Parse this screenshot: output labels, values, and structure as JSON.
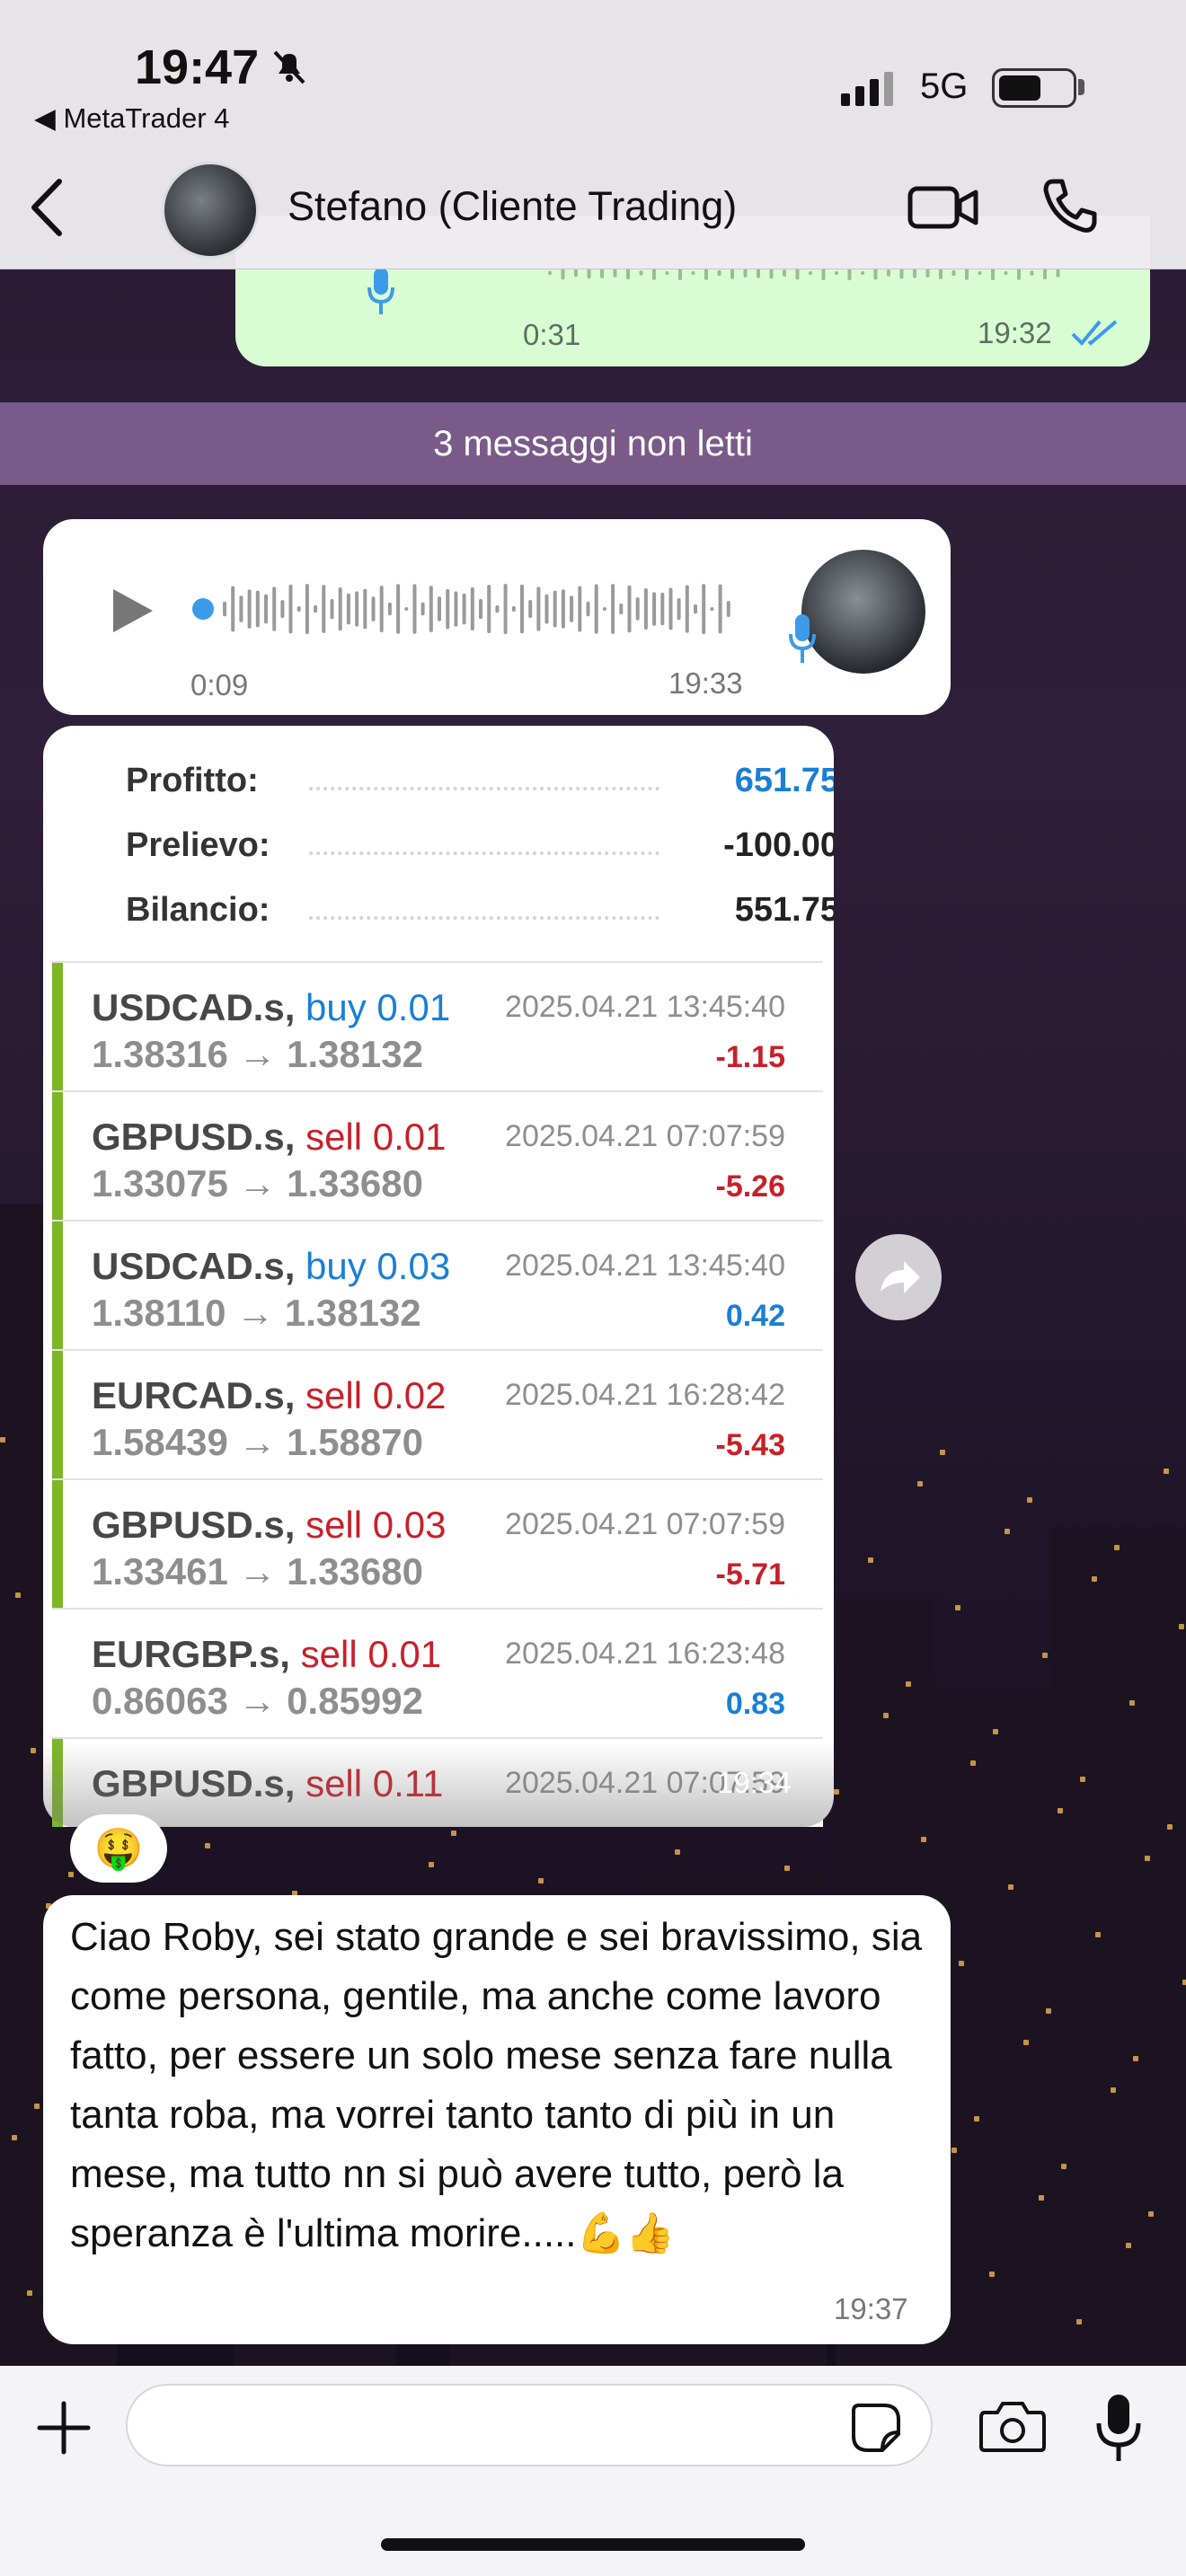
{
  "status_bar": {
    "time": "19:47",
    "back_app_label": "◀ MetaTrader 4",
    "network": "5G"
  },
  "header": {
    "contact_name": "Stefano (Cliente Trading)"
  },
  "outgoing_voice": {
    "duration": "0:31",
    "time": "19:32"
  },
  "unread_banner": "3 messaggi non letti",
  "incoming_voice": {
    "duration": "0:09",
    "time": "19:33"
  },
  "mt4_summary": [
    {
      "label": "Profitto:",
      "value": "651.75",
      "color": "#1a7fd4"
    },
    {
      "label": "Prelievo:",
      "value": "-100.00",
      "color": "#222222"
    },
    {
      "label": "Bilancio:",
      "value": "551.75",
      "color": "#222222"
    }
  ],
  "trades": [
    {
      "symbol": "USDCAD.s,",
      "side": "buy 0.01",
      "side_color": "#1a7fd4",
      "prices": "1.38316 → 1.38132",
      "datetime": "2025.04.21 13:45:40",
      "pl": "-1.15",
      "pl_color": "#c8202a",
      "bar": true
    },
    {
      "symbol": "GBPUSD.s,",
      "side": "sell 0.01",
      "side_color": "#c8202a",
      "prices": "1.33075 → 1.33680",
      "datetime": "2025.04.21 07:07:59",
      "pl": "-5.26",
      "pl_color": "#c8202a",
      "bar": true
    },
    {
      "symbol": "USDCAD.s,",
      "side": "buy 0.03",
      "side_color": "#1a7fd4",
      "prices": "1.38110 → 1.38132",
      "datetime": "2025.04.21 13:45:40",
      "pl": "0.42",
      "pl_color": "#1a7fd4",
      "bar": true
    },
    {
      "symbol": "EURCAD.s,",
      "side": "sell 0.02",
      "side_color": "#c8202a",
      "prices": "1.58439 → 1.58870",
      "datetime": "2025.04.21 16:28:42",
      "pl": "-5.43",
      "pl_color": "#c8202a",
      "bar": true
    },
    {
      "symbol": "GBPUSD.s,",
      "side": "sell 0.03",
      "side_color": "#c8202a",
      "prices": "1.33461 → 1.33680",
      "datetime": "2025.04.21 07:07:59",
      "pl": "-5.71",
      "pl_color": "#c8202a",
      "bar": true
    },
    {
      "symbol": "EURGBP.s,",
      "side": "sell 0.01",
      "side_color": "#c8202a",
      "prices": "0.86063 → 0.85992",
      "datetime": "2025.04.21 16:23:48",
      "pl": "0.83",
      "pl_color": "#1a7fd4",
      "bar": false
    },
    {
      "symbol": "GBPUSD.s,",
      "side": "sell 0.11",
      "side_color": "#c8202a",
      "prices": "",
      "datetime": "2025.04.21 07:07:59",
      "pl": "",
      "pl_color": "#c8202a",
      "bar": true
    }
  ],
  "image_time": "19:34",
  "reaction": "🤑",
  "text_message": {
    "text": "Ciao Roby, sei stato grande e sei bravissimo, sia come persona, gentile, ma anche come lavoro fatto, per essere un solo mese senza fare nulla tanta roba, ma vorrei tanto tanto di più in un mese, ma tutto nn si può avere tutto, però la speranza è l'ultima morire.....💪👍",
    "time": "19:37"
  },
  "colors": {
    "accent_blue": "#1a7fd4",
    "loss_red": "#c8202a",
    "mt4_green_bar": "#7db626",
    "outgoing_bubble": "#d9fdd3",
    "unread_banner": "#7a5a88"
  }
}
